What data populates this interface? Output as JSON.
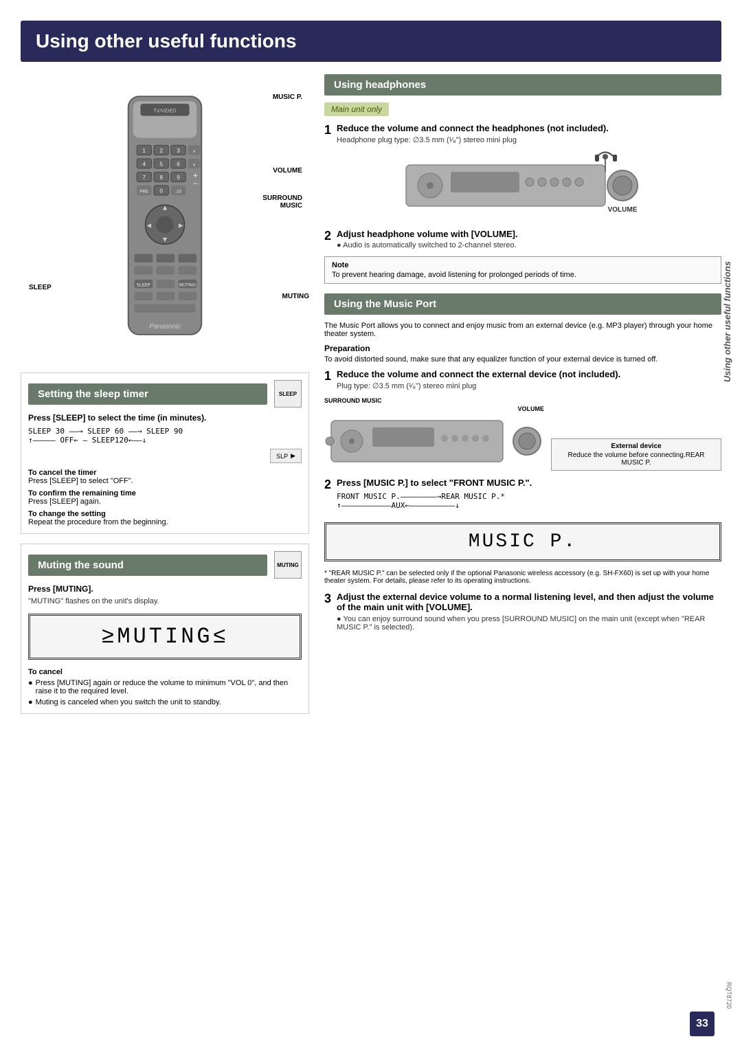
{
  "page": {
    "title": "Using other useful functions",
    "page_number": "33",
    "doc_code": "RQT8720"
  },
  "left_col": {
    "remote_labels": {
      "music_p": "MUSIC P.",
      "volume": "VOLUME",
      "surround_music": "SURROUND\nMUSIC",
      "sleep": "SLEEP",
      "muting": "MUTING"
    },
    "sleep_section": {
      "title": "Setting the sleep timer",
      "button_label": "SLEEP",
      "step1": {
        "heading": "Press [SLEEP] to select the time (in minutes).",
        "flow": "SLEEP 30 ——→ SLEEP 60 ——→ SLEEP 90",
        "flow2": "↑————— OFF← — SLEEP120←——↓"
      },
      "sub_instructions": [
        {
          "title": "To cancel the timer",
          "text": "Press [SLEEP] to select \"OFF\"."
        },
        {
          "title": "To confirm the remaining time",
          "text": "Press [SLEEP] again."
        },
        {
          "title": "To change the setting",
          "text": "Repeat the procedure from the beginning."
        }
      ]
    },
    "muting_section": {
      "title": "Muting the sound",
      "button_label": "MUTING",
      "step1": {
        "heading": "Press [MUTING].",
        "text": "\"MUTING\" flashes on the unit's display."
      },
      "display_text": "≥MUTING≤",
      "cancel_title": "To cancel",
      "cancel_bullets": [
        "Press [MUTING] again or reduce the volume to minimum \"VOL 0\", and then raise it to the required level.",
        "Muting is canceled when you switch the unit to standby."
      ]
    }
  },
  "right_col": {
    "headphones_section": {
      "title": "Using headphones",
      "badge": "Main unit only",
      "step1": {
        "num": "1",
        "heading": "Reduce the volume and connect the headphones (not included).",
        "note": "Headphone plug type: ∅3.5 mm (¹⁄₈\") stereo mini plug",
        "volume_label": "VOLUME"
      },
      "step2": {
        "num": "2",
        "heading": "Adjust headphone volume with [VOLUME].",
        "note": "● Audio is automatically switched to 2-channel stereo."
      },
      "note_box": {
        "label": "Note",
        "text": "To prevent hearing damage, avoid listening for prolonged periods of time."
      }
    },
    "music_port_section": {
      "title": "Using the Music Port",
      "intro": "The Music Port allows you to connect and enjoy music from an external device (e.g. MP3 player) through your home theater system.",
      "prep_title": "Preparation",
      "prep_text": "To avoid distorted sound, make sure that any equalizer function of your external device is turned off.",
      "step1": {
        "num": "1",
        "heading": "Reduce the volume and connect the external device (not included).",
        "note": "Plug type: ∅3.5 mm (¹⁄₈\") stereo mini plug",
        "surround_label": "SURROUND MUSIC",
        "volume_label": "VOLUME",
        "ext_device_title": "External device",
        "ext_device_text": "Reduce the volume before connecting.REAR MUSIC P."
      },
      "step2": {
        "num": "2",
        "heading": "Press [MUSIC P.] to select \"FRONT MUSIC P.\".",
        "flow": "FRONT MUSIC P.————————→REAR MUSIC P.*",
        "flow2": "↑———————————AUX←——————————↓"
      },
      "display_text": "MUSIC P.",
      "footnote": "* \"REAR MUSIC P.\" can be selected only if the optional Panasonic wireless accessory (e.g. SH-FX60) is set up with your home theater system. For details, please refer to its operating instructions.",
      "step3": {
        "num": "3",
        "heading": "Adjust the external device volume to a normal listening level, and then adjust the volume of the main unit with [VOLUME].",
        "note": "● You can enjoy surround sound when you press [SURROUND MUSIC] on the main unit (except when \"REAR MUSIC P.\" is selected)."
      }
    },
    "vertical_text": "Using other useful functions"
  }
}
